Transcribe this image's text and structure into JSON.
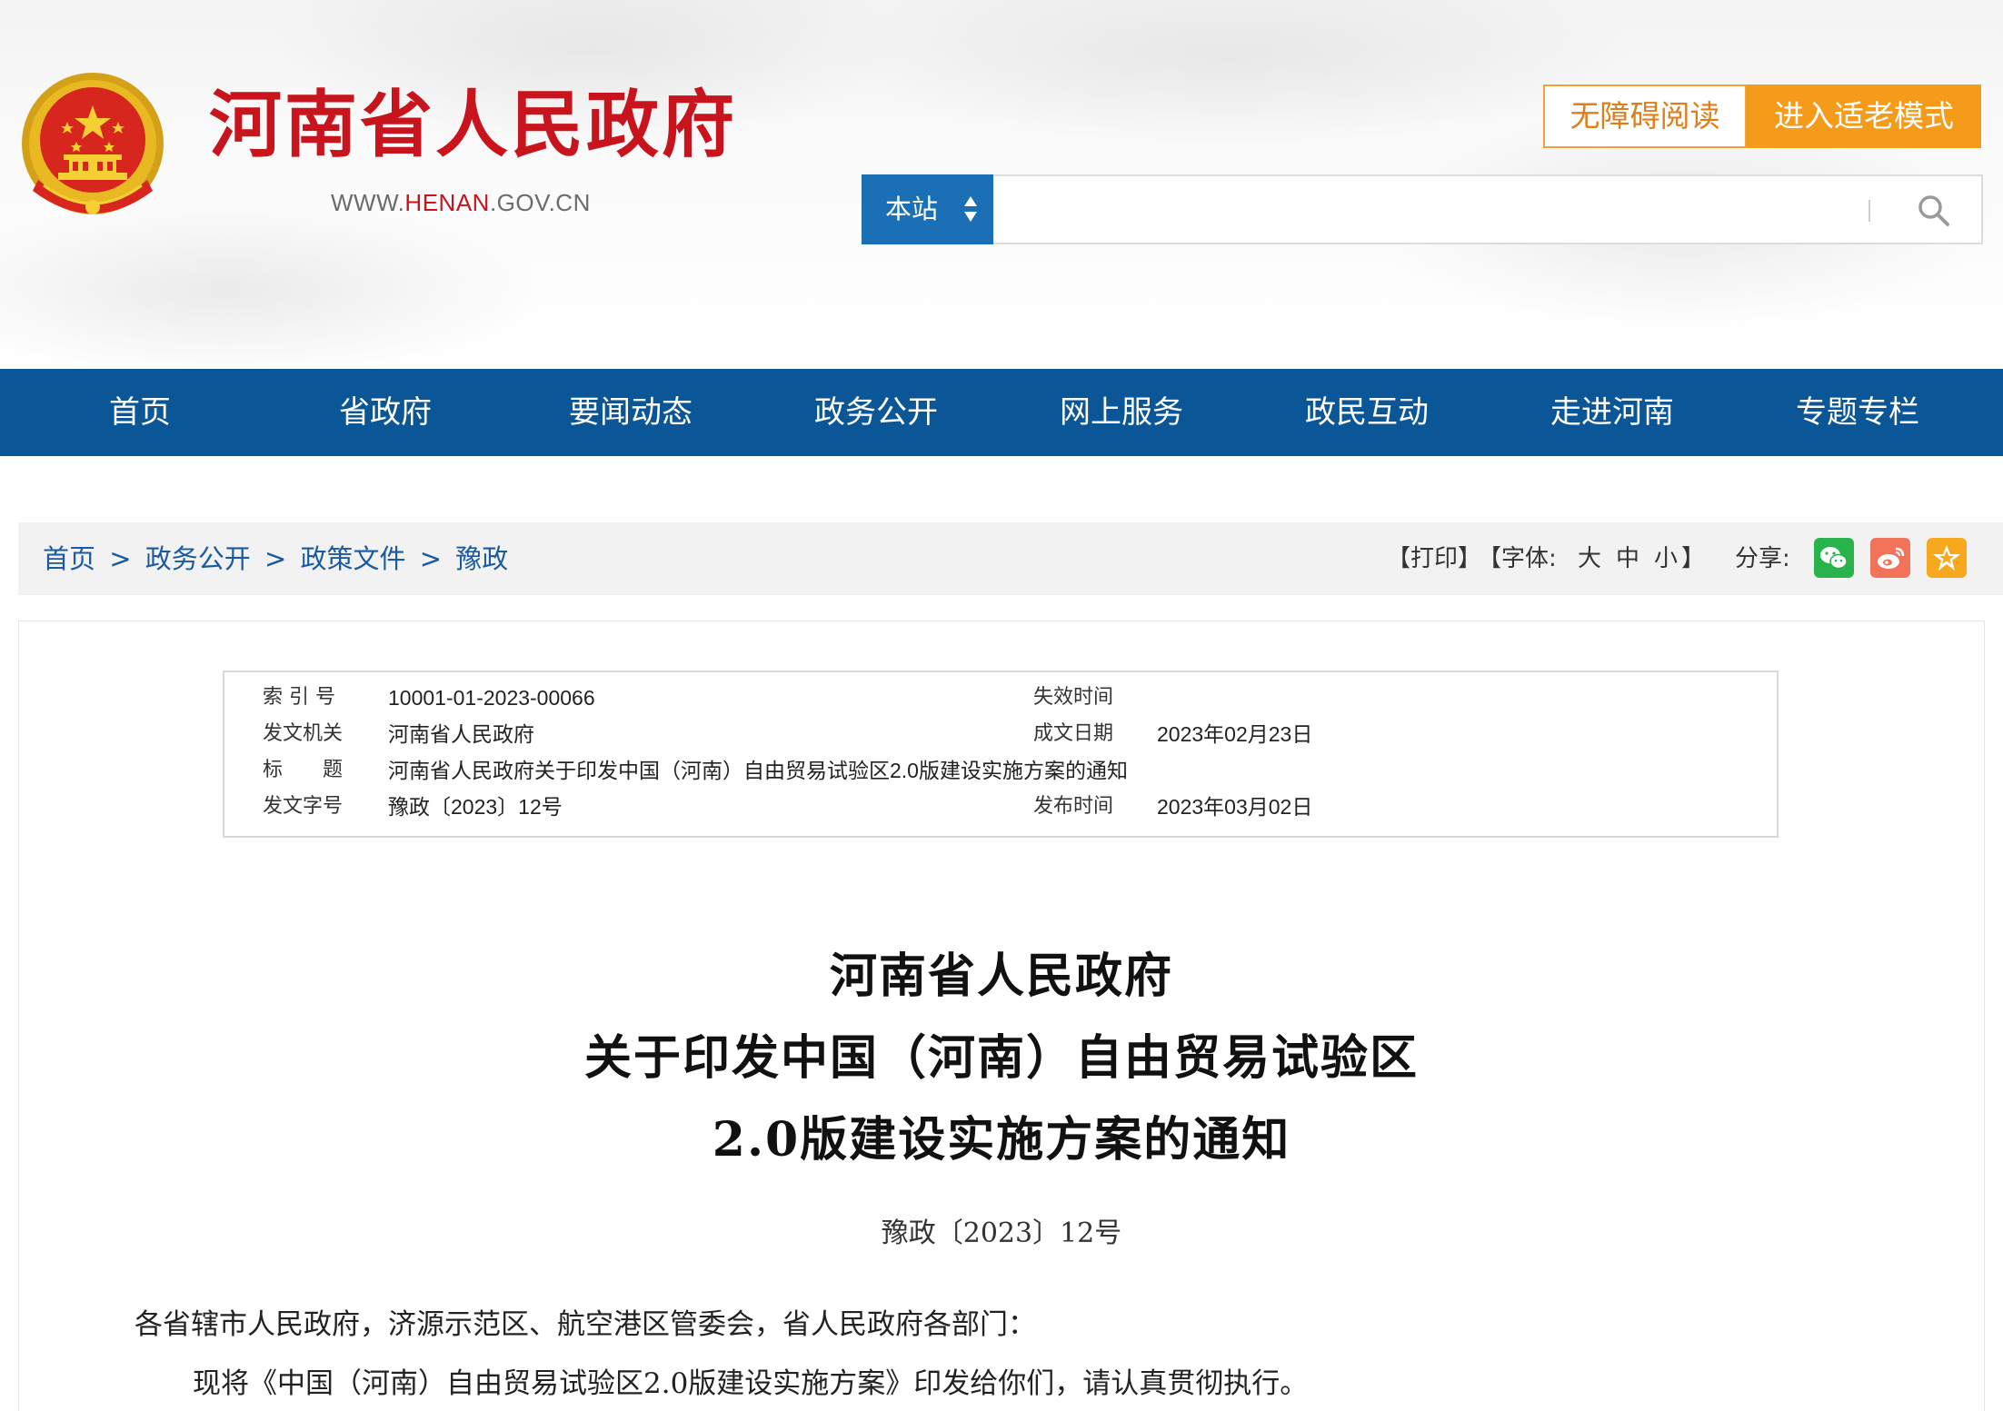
{
  "header": {
    "site_name": "河南省人民政府",
    "site_url_prefix": "WWW.",
    "site_url_domain": "HENAN",
    "site_url_suffix": ".GOV.CN",
    "accessibility_button": "无障碍阅读",
    "elder_mode_button": "进入适老模式",
    "search": {
      "scope": "本站",
      "placeholder": "",
      "value": ""
    }
  },
  "nav": {
    "items": [
      "首页",
      "省政府",
      "要闻动态",
      "政务公开",
      "网上服务",
      "政民互动",
      "走进河南",
      "专题专栏"
    ]
  },
  "breadcrumb": {
    "items": [
      "首页",
      "政务公开",
      "政策文件",
      "豫政"
    ],
    "separator": ">"
  },
  "tools": {
    "print": "【打印】",
    "font_prefix": "【字体:",
    "font_large": "大",
    "font_medium": "中",
    "font_small": "小",
    "font_suffix": "】",
    "share_label": "分享:"
  },
  "meta": {
    "index_label": "索 引 号",
    "index_value": "10001-01-2023-00066",
    "expire_label": "失效时间",
    "expire_value": "",
    "issuer_label": "发文机关",
    "issuer_value": "河南省人民政府",
    "created_label": "成文日期",
    "created_value": "2023年02月23日",
    "title_label": "标　　题",
    "title_value": "河南省人民政府关于印发中国（河南）自由贸易试验区2.0版建设实施方案的通知",
    "docno_label": "发文字号",
    "docno_value": "豫政〔2023〕12号",
    "published_label": "发布时间",
    "published_value": "2023年03月02日"
  },
  "document": {
    "title_line1": "河南省人民政府",
    "title_line2": "关于印发中国（河南）自由贸易试验区",
    "title_line3": "2.0版建设实施方案的通知",
    "doc_number": "豫政〔2023〕12号",
    "salutation": "各省辖市人民政府，济源示范区、航空港区管委会，省人民政府各部门：",
    "body_line1": "现将《中国（河南）自由贸易试验区2.0版建设实施方案》印发给你们，请认真贯彻执行。"
  },
  "colors": {
    "nav_blue": "#0b5696",
    "brand_red": "#c8151d",
    "accent_orange": "#f59b1a",
    "search_scope_blue": "#1a6fb5",
    "link_blue": "#1a5aa0"
  }
}
